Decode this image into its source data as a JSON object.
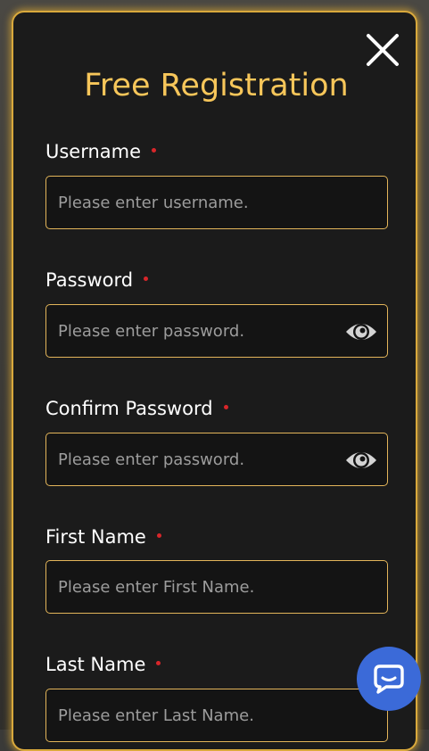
{
  "modal": {
    "title": "Free Registration",
    "close_icon": "close-icon"
  },
  "fields": {
    "username": {
      "label": "Username",
      "placeholder": "Please enter username.",
      "value": ""
    },
    "password": {
      "label": "Password",
      "placeholder": "Please enter password.",
      "value": "",
      "toggle_icon": "eye-icon"
    },
    "confirm_password": {
      "label": "Confirm Password",
      "placeholder": "Please enter password.",
      "value": "",
      "toggle_icon": "eye-icon"
    },
    "first_name": {
      "label": "First Name",
      "placeholder": "Please enter First Name.",
      "value": ""
    },
    "last_name": {
      "label": "Last Name",
      "placeholder": "Please enter Last Name.",
      "value": ""
    }
  },
  "chat": {
    "icon": "chat-bubble-icon"
  },
  "colors": {
    "accent_gold": "#f7c65a",
    "border_gold": "#e3b55a",
    "required_red": "#d8262a",
    "chat_blue": "#3b6ad8",
    "panel_bg": "#1b1b1b"
  }
}
